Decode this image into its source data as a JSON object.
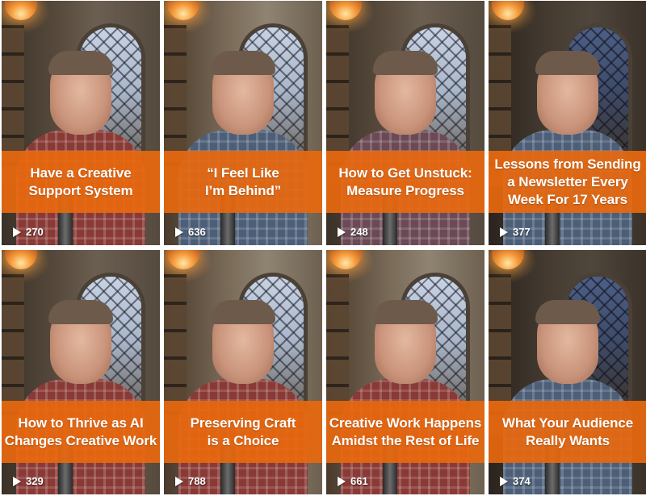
{
  "videos": [
    {
      "title": "Have a Creative\nSupport System",
      "views": "270"
    },
    {
      "title": "“I Feel Like\nI’m Behind”",
      "views": "636"
    },
    {
      "title": "How to Get Unstuck:\nMeasure Progress",
      "views": "248"
    },
    {
      "title": "Lessons from Sending\na Newsletter Every\nWeek For 17 Years",
      "views": "377"
    },
    {
      "title": "How to Thrive as AI\nChanges Creative Work",
      "views": "329"
    },
    {
      "title": "Preserving Craft\nis a Choice",
      "views": "788"
    },
    {
      "title": "Creative Work Happens\nAmidst the Rest of Life",
      "views": "661"
    },
    {
      "title": "What Your Audience\nReally Wants",
      "views": "374"
    }
  ],
  "icons": {
    "views_icon": "play-icon"
  },
  "colors": {
    "caption_bar": "#e8680e",
    "caption_text": "#ffffff"
  }
}
